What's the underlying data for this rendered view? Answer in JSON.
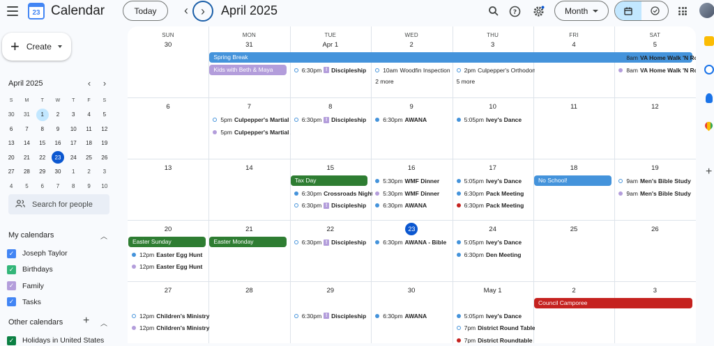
{
  "header": {
    "app_title": "Calendar",
    "logo_text": "23",
    "today_label": "Today",
    "month_title": "April 2025",
    "view_select": "Month"
  },
  "sidebar": {
    "create_label": "Create",
    "mini_calendar": {
      "title": "April 2025",
      "dow": [
        "S",
        "M",
        "T",
        "W",
        "T",
        "F",
        "S"
      ],
      "weeks": [
        [
          "30",
          "31",
          "1",
          "2",
          "3",
          "4",
          "5"
        ],
        [
          "6",
          "7",
          "8",
          "9",
          "10",
          "11",
          "12"
        ],
        [
          "13",
          "14",
          "15",
          "16",
          "17",
          "18",
          "19"
        ],
        [
          "20",
          "21",
          "22",
          "23",
          "24",
          "25",
          "26"
        ],
        [
          "27",
          "28",
          "29",
          "30",
          "1",
          "2",
          "3"
        ],
        [
          "4",
          "5",
          "6",
          "7",
          "8",
          "9",
          "10"
        ]
      ],
      "selected": "1",
      "today": "23"
    },
    "search_people_placeholder": "Search for people",
    "my_calendars": {
      "title": "My calendars",
      "items": [
        {
          "label": "Joseph Taylor",
          "color": "#4285f4"
        },
        {
          "label": "Birthdays",
          "color": "#33b679"
        },
        {
          "label": "Family",
          "color": "#b39ddb"
        },
        {
          "label": "Tasks",
          "color": "#4285f4"
        }
      ]
    },
    "other_calendars": {
      "title": "Other calendars",
      "items": [
        {
          "label": "Holidays in United States",
          "color": "#0b8043"
        }
      ]
    }
  },
  "calendar": {
    "dow": [
      "SUN",
      "MON",
      "TUE",
      "WED",
      "THU",
      "FRI",
      "SAT"
    ],
    "weeks": [
      [
        "30",
        "31",
        "Apr 1",
        "2",
        "3",
        "4",
        "5"
      ],
      [
        "6",
        "7",
        "8",
        "9",
        "10",
        "11",
        "12"
      ],
      [
        "13",
        "14",
        "15",
        "16",
        "17",
        "18",
        "19"
      ],
      [
        "20",
        "21",
        "22",
        "23",
        "24",
        "25",
        "26"
      ],
      [
        "27",
        "28",
        "29",
        "30",
        "May 1",
        "2",
        "3"
      ]
    ],
    "bars": [
      {
        "week": 0,
        "start": 1,
        "span": 5.95,
        "slot": 0,
        "label": "Spring Break",
        "color": "#4493db"
      },
      {
        "week": 0,
        "start": 1,
        "span": 0.95,
        "slot": 1,
        "label": "Kids with Beth & Maya",
        "color": "#b39ddb"
      },
      {
        "week": 2,
        "start": 2,
        "span": 0.95,
        "slot": 0,
        "label": "Tax Day",
        "color": "#2e7d32"
      },
      {
        "week": 2,
        "start": 5,
        "span": 0.95,
        "slot": 0,
        "label": "No School!",
        "color": "#4493db"
      },
      {
        "week": 3,
        "start": 0,
        "span": 0.95,
        "slot": 0,
        "label": "Easter Sunday",
        "color": "#2e7d32"
      },
      {
        "week": 3,
        "start": 1,
        "span": 0.95,
        "slot": 0,
        "label": "Easter Monday",
        "color": "#2e7d32"
      },
      {
        "week": 4,
        "start": 5,
        "span": 1.95,
        "slot": 0,
        "label": "Council Camporee",
        "color": "#c5221f"
      }
    ],
    "events": [
      {
        "week": 0,
        "day": 2,
        "slot": 1,
        "time": "6:30pm",
        "title": "Discipleship",
        "color": "#4493db",
        "ring": true,
        "excl": true
      },
      {
        "week": 0,
        "day": 3,
        "slot": 1,
        "time": "10am",
        "title": "Woodfin Inspection",
        "color": "#4493db",
        "ring": true,
        "plain": true
      },
      {
        "week": 0,
        "day": 4,
        "slot": 1,
        "time": "2pm",
        "title": "Culpepper's Orthodontist",
        "color": "#4493db",
        "ring": true,
        "plain": true
      },
      {
        "week": 0,
        "day": 6,
        "slot": 0,
        "time": "8am",
        "title": "VA Home Walk 'N Roll",
        "color": "#4493db"
      },
      {
        "week": 0,
        "day": 6,
        "slot": 1,
        "time": "8am",
        "title": "VA Home Walk 'N Roll",
        "color": "#b39ddb"
      },
      {
        "week": 1,
        "day": 1,
        "slot": 0,
        "time": "5pm",
        "title": "Culpepper's Martial Arts",
        "color": "#4493db",
        "ring": true
      },
      {
        "week": 1,
        "day": 1,
        "slot": 1,
        "time": "5pm",
        "title": "Culpepper's Martial Arts",
        "color": "#b39ddb"
      },
      {
        "week": 1,
        "day": 2,
        "slot": 0,
        "time": "6:30pm",
        "title": "Discipleship",
        "color": "#4493db",
        "ring": true,
        "excl": true
      },
      {
        "week": 1,
        "day": 3,
        "slot": 0,
        "time": "6:30pm",
        "title": "AWANA",
        "color": "#4493db"
      },
      {
        "week": 1,
        "day": 4,
        "slot": 0,
        "time": "5:05pm",
        "title": "Ivey's Dance",
        "color": "#4493db"
      },
      {
        "week": 2,
        "day": 2,
        "slot": 1,
        "time": "6:30pm",
        "title": "Crossroads Night",
        "color": "#4493db"
      },
      {
        "week": 2,
        "day": 2,
        "slot": 2,
        "time": "6:30pm",
        "title": "Discipleship",
        "color": "#4493db",
        "ring": true,
        "excl": true
      },
      {
        "week": 2,
        "day": 3,
        "slot": 0,
        "time": "5:30pm",
        "title": "WMF Dinner",
        "color": "#4493db"
      },
      {
        "week": 2,
        "day": 3,
        "slot": 1,
        "time": "5:30pm",
        "title": "WMF Dinner",
        "color": "#b39ddb"
      },
      {
        "week": 2,
        "day": 3,
        "slot": 2,
        "time": "6:30pm",
        "title": "AWANA",
        "color": "#4493db"
      },
      {
        "week": 2,
        "day": 4,
        "slot": 0,
        "time": "5:05pm",
        "title": "Ivey's Dance",
        "color": "#4493db"
      },
      {
        "week": 2,
        "day": 4,
        "slot": 1,
        "time": "6:30pm",
        "title": "Pack Meeting",
        "color": "#4493db"
      },
      {
        "week": 2,
        "day": 4,
        "slot": 2,
        "time": "6:30pm",
        "title": "Pack Meeting",
        "color": "#c5221f"
      },
      {
        "week": 2,
        "day": 6,
        "slot": 0,
        "time": "9am",
        "title": "Men's Bible Study",
        "color": "#4493db",
        "ring": true
      },
      {
        "week": 2,
        "day": 6,
        "slot": 1,
        "time": "9am",
        "title": "Men's Bible Study",
        "color": "#b39ddb"
      },
      {
        "week": 3,
        "day": 0,
        "slot": 1,
        "time": "12pm",
        "title": "Easter Egg Hunt",
        "color": "#4493db"
      },
      {
        "week": 3,
        "day": 0,
        "slot": 2,
        "time": "12pm",
        "title": "Easter Egg Hunt",
        "color": "#b39ddb"
      },
      {
        "week": 3,
        "day": 2,
        "slot": 0,
        "time": "6:30pm",
        "title": "Discipleship",
        "color": "#4493db",
        "ring": true,
        "excl": true
      },
      {
        "week": 3,
        "day": 3,
        "slot": 0,
        "time": "6:30pm",
        "title": "AWANA - Bible",
        "color": "#4493db"
      },
      {
        "week": 3,
        "day": 4,
        "slot": 0,
        "time": "5:05pm",
        "title": "Ivey's Dance",
        "color": "#4493db"
      },
      {
        "week": 3,
        "day": 4,
        "slot": 1,
        "time": "6:30pm",
        "title": "Den Meeting",
        "color": "#4493db"
      },
      {
        "week": 4,
        "day": 0,
        "slot": 1,
        "time": "12pm",
        "title": "Children's Ministry",
        "color": "#4493db",
        "ring": true
      },
      {
        "week": 4,
        "day": 0,
        "slot": 2,
        "time": "12pm",
        "title": "Children's Ministry",
        "color": "#b39ddb"
      },
      {
        "week": 4,
        "day": 2,
        "slot": 1,
        "time": "6:30pm",
        "title": "Discipleship",
        "color": "#4493db",
        "ring": true,
        "excl": true
      },
      {
        "week": 4,
        "day": 3,
        "slot": 1,
        "time": "6:30pm",
        "title": "AWANA",
        "color": "#4493db"
      },
      {
        "week": 4,
        "day": 4,
        "slot": 1,
        "time": "5:05pm",
        "title": "Ivey's Dance",
        "color": "#4493db"
      },
      {
        "week": 4,
        "day": 4,
        "slot": 2,
        "time": "7pm",
        "title": "District Round Table",
        "color": "#4493db",
        "ring": true
      },
      {
        "week": 4,
        "day": 4,
        "slot": 3,
        "time": "7pm",
        "title": "District Roundtable",
        "color": "#c5221f"
      }
    ],
    "more": [
      {
        "week": 0,
        "day": 3,
        "slot": 2,
        "label": "2 more"
      },
      {
        "week": 0,
        "day": 4,
        "slot": 2,
        "label": "5 more"
      }
    ],
    "today": "23"
  },
  "colors": {
    "accent": "#0b57d0",
    "accent_light": "#c2e7ff"
  }
}
